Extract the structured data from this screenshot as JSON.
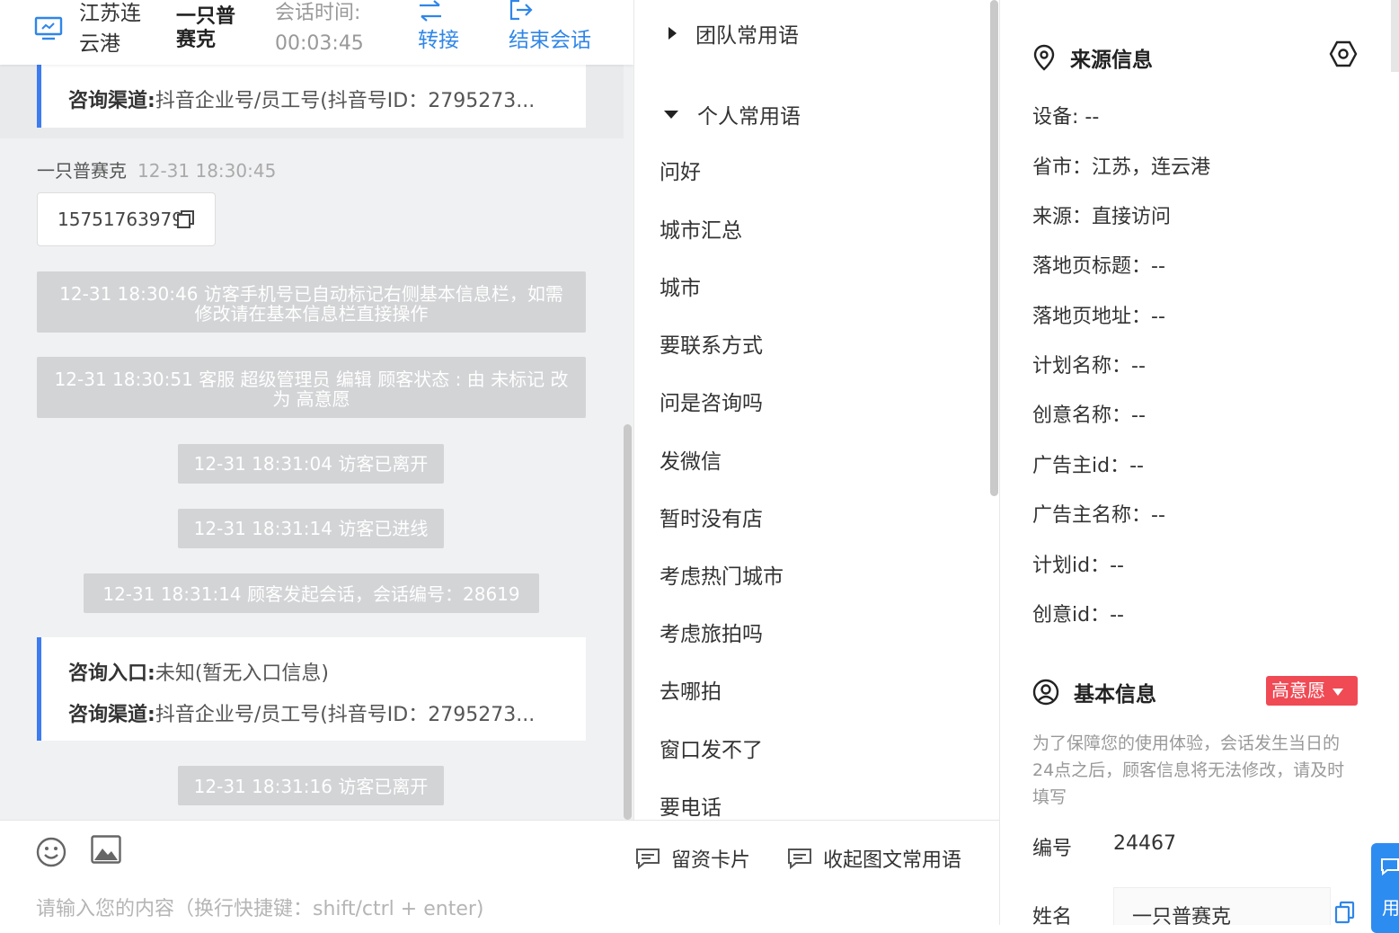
{
  "header": {
    "location": "江苏连云港",
    "visitor_name": "一只普赛克",
    "session_time_label": "会话时间:",
    "session_time": "00:03:45",
    "transfer_label": "转接",
    "end_label": "结束会话"
  },
  "chat": {
    "prev_card": {
      "channel_label": "咨询渠道:",
      "channel_value": "抖音企业号/员工号(抖音号ID：2795273..."
    },
    "sender_name": "一只普赛克",
    "sender_time": "12-31 18:30:45",
    "phone": "15751763979",
    "system_messages": [
      "12-31 18:30:46 访客手机号已自动标记右侧基本信息栏，如需修改请在基本信息栏直接操作",
      "12-31 18:30:51 客服 超级管理员 编辑 顾客状态 : 由 未标记 改为 高意愿",
      "12-31 18:31:04 访客已离开",
      "12-31 18:31:14 访客已进线",
      "12-31 18:31:14 顾客发起会话，会话编号：28619",
      "12-31 18:31:16 访客已离开"
    ],
    "entry_card": {
      "entry_label": "咨询入口:",
      "entry_value": "未知(暂无入口信息)",
      "channel_label": "咨询渠道:",
      "channel_value": "抖音企业号/员工号(抖音号ID：2795273..."
    }
  },
  "composer": {
    "card_btn": "留资卡片",
    "collapse_btn": "收起图文常用语",
    "placeholder": "请输入您的内容（换行快捷键：shift/ctrl + enter)"
  },
  "phrases": {
    "team_group": "团队常用语",
    "personal_group": "个人常用语",
    "items": [
      "问好",
      "城市汇总",
      "城市",
      "要联系方式",
      "问是咨询吗",
      "发微信",
      "暂时没有店",
      "考虑热门城市",
      "考虑旅拍吗",
      "去哪拍",
      "窗口发不了",
      "要电话"
    ]
  },
  "source_info": {
    "title": "来源信息",
    "fields": [
      "设备: --",
      "省市：江苏，连云港",
      "来源：直接访问",
      "落地页标题：--",
      "落地页地址：--",
      "计划名称：--",
      "创意名称：--",
      "广告主id：--",
      "广告主名称：--",
      "计划id：--",
      "创意id：--"
    ]
  },
  "basic_info": {
    "title": "基本信息",
    "badge": "高意愿",
    "notice": "为了保障您的使用体验，会话发生当日的24点之后，顾客信息将无法修改，请及时填写",
    "id_label": "编号",
    "id_value": "24467",
    "name_label": "姓名",
    "name_value": "一只普赛克"
  },
  "float_tab": {
    "label": "用"
  },
  "colors": {
    "accent": "#2f86e8",
    "card_border": "#3d7cf0",
    "badge": "#f04a55",
    "system_bg": "#d3d4d6"
  }
}
